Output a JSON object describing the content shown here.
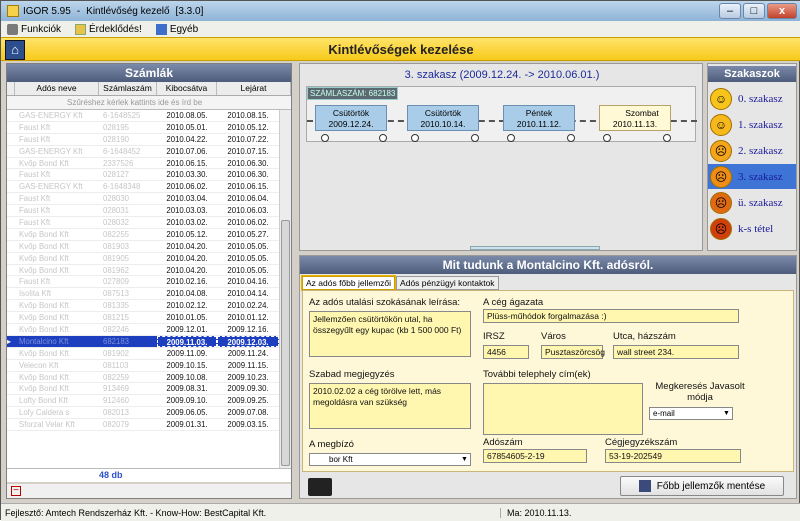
{
  "window": {
    "title_app": "IGOR 5.95",
    "title_sep": "-",
    "title_name": "Kintlévőség kezelő",
    "title_ver": "[3.3.0]",
    "btn_min": "–",
    "btn_max": "□",
    "btn_close": "x"
  },
  "menu": {
    "items": [
      {
        "label": "Funkciók",
        "icon": "tools-icon"
      },
      {
        "label": "Érdeklődés!",
        "icon": "note-icon"
      },
      {
        "label": "Egyéb",
        "icon": "info-icon"
      }
    ]
  },
  "banner": {
    "title": "Kintlévőségek kezelése",
    "home_icon": "home-icon"
  },
  "left": {
    "title": "Számlák",
    "columns": [
      "Adós neve",
      "Számlaszám",
      "Kibocsátva",
      "Lejárat"
    ],
    "filter_hint": "Szűréshez kérlek kattints ide és írd be",
    "rows": [
      {
        "name": "GAS-ENERGY Kft",
        "no": "6-1648525",
        "issued": "2010.08.05.",
        "due": "2010.08.15."
      },
      {
        "name": "Faust Kft",
        "no": "028195",
        "issued": "2010.05.01.",
        "due": "2010.05.12."
      },
      {
        "name": "Faust Kft",
        "no": "028190",
        "issued": "2010.04.22.",
        "due": "2010.07.22."
      },
      {
        "name": "GAS-ENERGY Kft",
        "no": "6-1648452",
        "issued": "2010.07.06.",
        "due": "2010.07.15."
      },
      {
        "name": "Kvőp Bond Kft",
        "no": "2337526",
        "issued": "2010.06.15.",
        "due": "2010.06.30."
      },
      {
        "name": "Faust Kft",
        "no": "028127",
        "issued": "2010.03.30.",
        "due": "2010.06.30."
      },
      {
        "name": "GAS-ENERGY Kft",
        "no": "6-1648348",
        "issued": "2010.06.02.",
        "due": "2010.06.15."
      },
      {
        "name": "Faust Kft",
        "no": "028030",
        "issued": "2010.03.04.",
        "due": "2010.06.04."
      },
      {
        "name": "Faust Kft",
        "no": "028031",
        "issued": "2010.03.03.",
        "due": "2010.06.03."
      },
      {
        "name": "Faust Kft",
        "no": "028032",
        "issued": "2010.03.02.",
        "due": "2010.06.02."
      },
      {
        "name": "Kvőp Bond Kft",
        "no": "082255",
        "issued": "2010.05.12.",
        "due": "2010.05.27."
      },
      {
        "name": "Kvőp Bond Kft",
        "no": "081903",
        "issued": "2010.04.20.",
        "due": "2010.05.05."
      },
      {
        "name": "Kvőp Bond Kft",
        "no": "081905",
        "issued": "2010.04.20.",
        "due": "2010.05.05."
      },
      {
        "name": "Kvőp Bond Kft",
        "no": "081962",
        "issued": "2010.04.20.",
        "due": "2010.05.05."
      },
      {
        "name": "Faust Kft",
        "no": "027809",
        "issued": "2010.02.16.",
        "due": "2010.04.16."
      },
      {
        "name": "Isolita Kft",
        "no": "087513",
        "issued": "2010.04.08.",
        "due": "2010.04.14."
      },
      {
        "name": "Kvőp Bond Kft",
        "no": "081335",
        "issued": "2010.02.12.",
        "due": "2010.02.24."
      },
      {
        "name": "Kvőp Bond Kft",
        "no": "081215",
        "issued": "2010.01.05.",
        "due": "2010.01.12."
      },
      {
        "name": "Kvőp Bond Kft",
        "no": "082246",
        "issued": "2009.12.01.",
        "due": "2009.12.16."
      },
      {
        "name": "Montalcino Kft",
        "no": "682183",
        "issued": "2009.11.03.",
        "due": "2009.12.03.",
        "sel": true
      },
      {
        "name": "Kvőp Bond Kft",
        "no": "081902",
        "issued": "2009.11.09.",
        "due": "2009.11.24."
      },
      {
        "name": "Velecon Kft",
        "no": "081103",
        "issued": "2009.10.15.",
        "due": "2009.11.15."
      },
      {
        "name": "Kvőp Bond Kft",
        "no": "082259",
        "issued": "2009.10.08.",
        "due": "2009.10.23."
      },
      {
        "name": "Kvőp Bond Kft",
        "no": "913469",
        "issued": "2009.08.31.",
        "due": "2009.09.30."
      },
      {
        "name": "Lofty Bond Kft",
        "no": "912460",
        "issued": "2009.09.10.",
        "due": "2009.09.25."
      },
      {
        "name": "Lofy Caldera s",
        "no": "082013",
        "issued": "2009.06.05.",
        "due": "2009.07.08."
      },
      {
        "name": "Sforzal Velar Kft",
        "no": "082079",
        "issued": "2009.01.31.",
        "due": "2009.03.15."
      }
    ],
    "count": "48 db"
  },
  "stage": {
    "title": "3. szakasz  (2009.12.24.   -> 2010.06.01.)",
    "invoice_tag": "SZÁMLASZÁM: 682183",
    "boxes": [
      {
        "day": "Csütörtök",
        "date": "2009.12.24."
      },
      {
        "day": "Csütörtök",
        "date": "2010.10.14."
      },
      {
        "day": "Péntek",
        "date": "2010.11.12."
      },
      {
        "day": "Szombat",
        "date": "2010.11.13."
      }
    ]
  },
  "szakaszok": {
    "title": "Szakaszok",
    "items": [
      {
        "label": "0. szakasz",
        "bg": "#f6c41b"
      },
      {
        "label": "1. szakasz",
        "bg": "#f6b81b"
      },
      {
        "label": "2. szakasz",
        "bg": "#f5a51a"
      },
      {
        "label": "3. szakasz",
        "bg": "#f08d15",
        "active": true
      },
      {
        "label": "ü. szakasz",
        "bg": "#e06a12"
      },
      {
        "label": "k-s tétel",
        "bg": "#d0400e"
      }
    ]
  },
  "info": {
    "title": "Mit tudunk a Montalcino Kft. adósról.",
    "tabs": [
      "Az adós főbb jellemzői",
      "Adós pénzügyi kontaktok"
    ],
    "labels": {
      "habit": "Az adós utalási szokásának leírása:",
      "sector": "A cég ágazata",
      "irsz": "IRSZ",
      "city": "Város",
      "street": "Utca, házszám",
      "note": "Szabad megjegyzés",
      "other": "További telephely cím(ek)",
      "req": "Megkeresés Javasolt módja",
      "client": "A megbízó",
      "tax": "Adószám",
      "regno": "Cégjegyzékszám"
    },
    "values": {
      "habit": "Jellemzően csütörtökön utal, ha összegyűlt egy kupac (kb 1 500 000 Ft)",
      "sector": "Plüss-műhódok forgalmazása :)",
      "irsz": "4456",
      "city": "Pusztaszörcsög",
      "street": "wall street 234.",
      "note": "2010.02.02 a cég törölve lett, más megoldásra van szükség",
      "req": "e-mail",
      "client": "bor Kft",
      "tax": "67854605-2-19",
      "regno": "53-19-202549"
    },
    "save": "Főbb jellemzők mentése"
  },
  "status": {
    "left": "Fejlesztő: Amtech Rendszerház Kft. - Know-How: BestCapital Kft.",
    "right": "Ma: 2010.11.13."
  }
}
